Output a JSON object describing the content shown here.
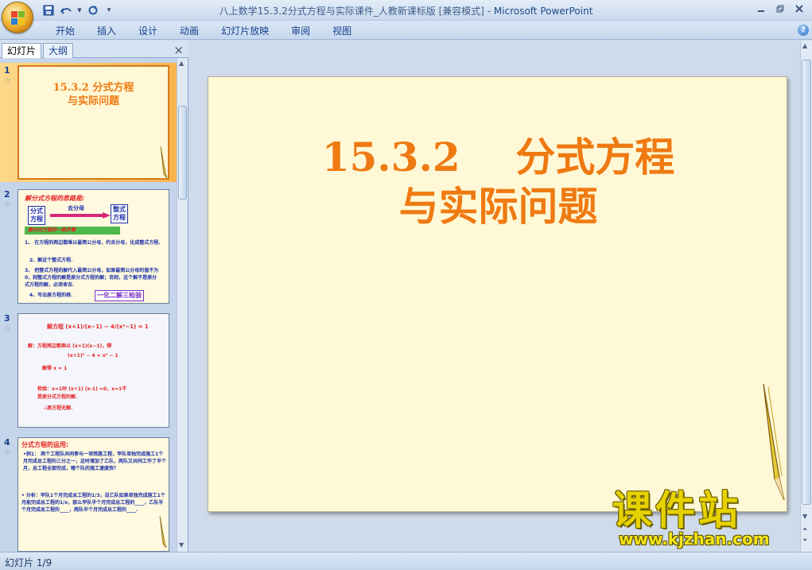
{
  "window": {
    "title_doc": "八上数学15.3.2分式方程与实际课件_人教新课标版 [兼容模式] - ",
    "title_app": "Microsoft PowerPoint",
    "help": "?"
  },
  "ribbon": {
    "tabs": [
      "开始",
      "插入",
      "设计",
      "动画",
      "幻灯片放映",
      "审阅",
      "视图"
    ]
  },
  "left_pane": {
    "tabs": [
      "幻灯片",
      "大纲"
    ],
    "close": "×"
  },
  "thumbnails": [
    {
      "number": "1",
      "title_line1": "15.3.2   分式方程",
      "title_line2": "与实际问题"
    },
    {
      "number": "2",
      "heading": "解分式方程的思路是:",
      "box_left": "分式\n方程",
      "arrow_label": "去分母",
      "box_right": "整式\n方程",
      "green_label": "解分式方程的一般步骤",
      "step1": "1、 在方程的两边都乘以最简公分母，约去分母，化成整式方程.",
      "step2": "2、解这个整式方程.",
      "step3": "3、 把整式方程的解代入最简公分母，如果最简公分母的值不为0，则整式方程的解是原分式方程的解；否则，这个解不是原分式方程的解，必须舍去.",
      "step4": "4、写出原方程的根.",
      "motto": "一化二解三检验"
    },
    {
      "number": "3",
      "eq": "解方程  (x+1)/(x−1) − 4/(x²−1) = 1",
      "sol1": "解：方程两边都乘以 (x+1)(x−1)，得",
      "sol2": "(x+1)² − 4 = x² − 1",
      "sol3": "解得        x = 1",
      "check1": "检验：x=1时 (x+1) (x-1) =0，x=1不",
      "check2": "是原分式方程的解.",
      "conclusion": "∴原方程无解."
    },
    {
      "number": "4",
      "heading": "分式方程的运用:",
      "ex1": "•例1： 两个工程队共同参与一项筑路工程，甲队单独完成施工1个月完成总工程的三分之一，这时增加了乙队，两队又共同工作了半个月，总工程全部完成，哪个队的施工速度快？",
      "ana": "• 分析：甲队1个月完成总工程的1/3，设乙队如果单独完成施工1个月能完成总工程的1/x，那么甲队半个月完成总工程的____，乙队半个月完成总工程的____，两队半个月完成总工程的____."
    }
  ],
  "slide": {
    "title_line1": "15.3.2    分式方程",
    "title_line2": "与实际问题"
  },
  "watermark": {
    "main": "课件站",
    "url": "www.kjzhan.com"
  },
  "status": {
    "slide_info": "幻灯片 1/9"
  },
  "colors": {
    "title_orange": "#ef7a12",
    "slide_bg": "#fef8d6",
    "ribbon_text": "#15428b"
  }
}
